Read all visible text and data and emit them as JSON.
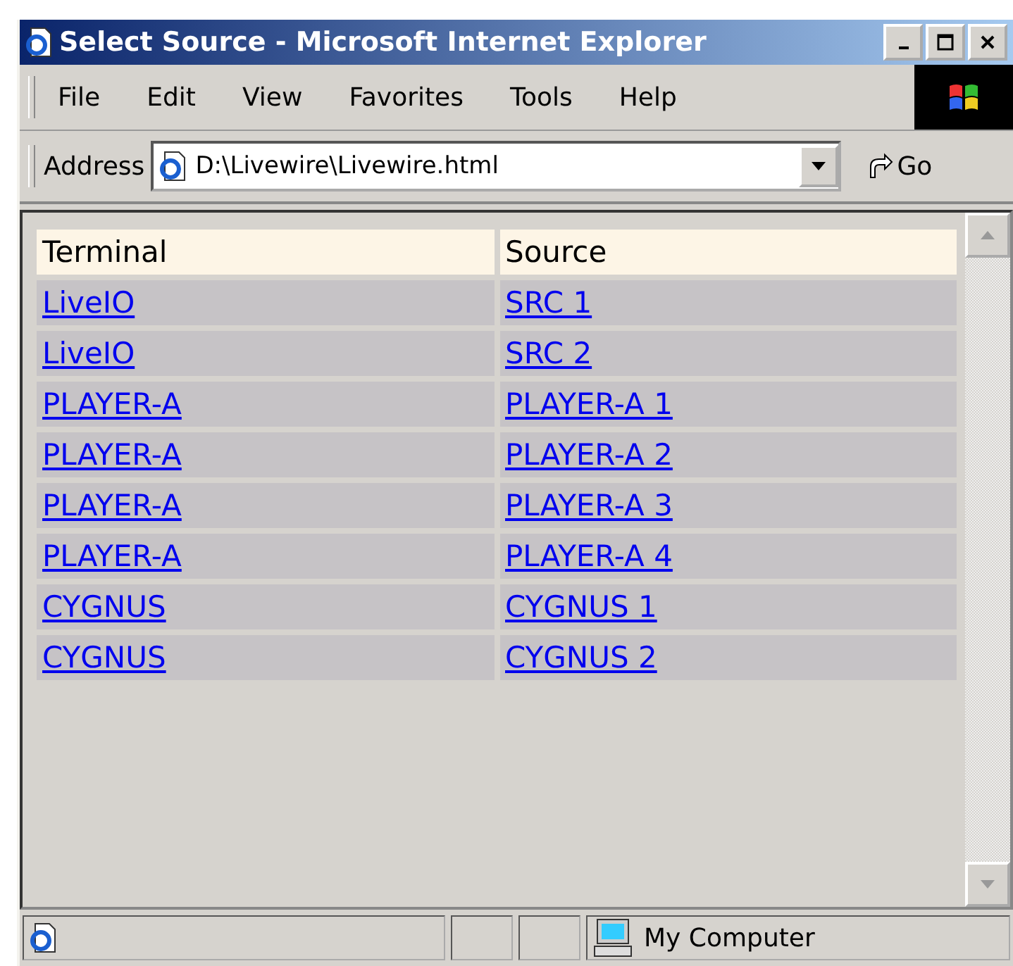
{
  "window": {
    "title": "Select Source - Microsoft Internet Explorer"
  },
  "menu": [
    "File",
    "Edit",
    "View",
    "Favorites",
    "Tools",
    "Help"
  ],
  "address": {
    "label": "Address",
    "value": "D:\\Livewire\\Livewire.html",
    "go": "Go"
  },
  "table": {
    "columns": [
      "Terminal",
      "Source"
    ],
    "rows": [
      [
        "LiveIO",
        "SRC 1"
      ],
      [
        "LiveIO",
        "SRC 2"
      ],
      [
        "PLAYER-A",
        "PLAYER-A 1"
      ],
      [
        "PLAYER-A",
        "PLAYER-A 2"
      ],
      [
        "PLAYER-A",
        "PLAYER-A 3"
      ],
      [
        "PLAYER-A",
        "PLAYER-A 4"
      ],
      [
        "CYGNUS",
        "CYGNUS 1"
      ],
      [
        "CYGNUS",
        "CYGNUS 2"
      ]
    ]
  },
  "status_bar": {
    "zone": "My Computer"
  }
}
